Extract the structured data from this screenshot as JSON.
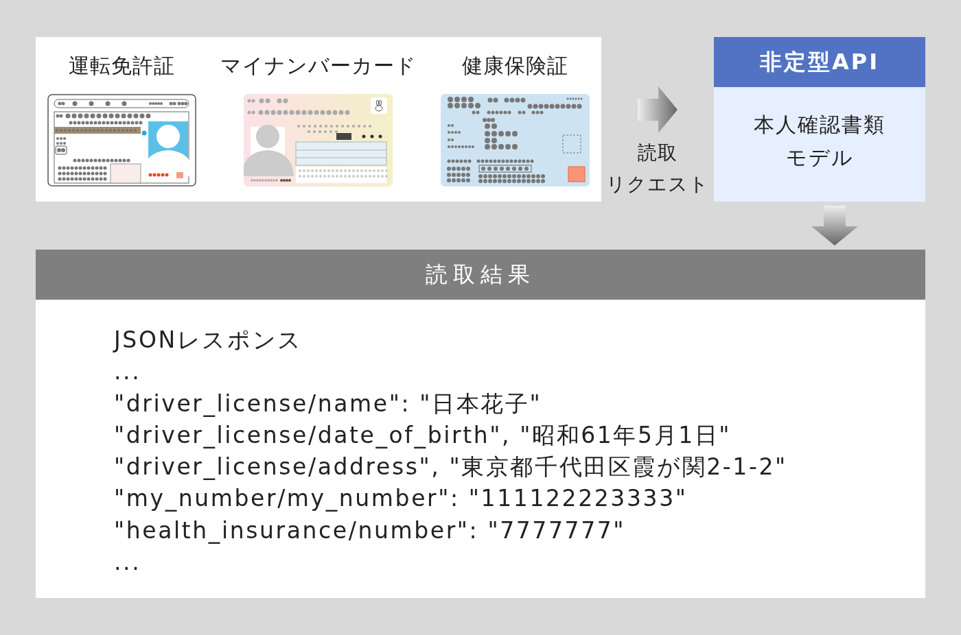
{
  "documents": [
    {
      "label": "運転免許証",
      "kind": "license"
    },
    {
      "label": "マイナンバーカード",
      "kind": "mynumber"
    },
    {
      "label": "健康保険証",
      "kind": "insurance"
    }
  ],
  "request": {
    "lines": [
      "読取",
      "リクエスト"
    ]
  },
  "api": {
    "title": "非定型API",
    "model_lines": [
      "本人確認書類",
      "モデル"
    ]
  },
  "result": {
    "title": "読取結果",
    "lines": [
      "JSONレスポンス",
      "...",
      "\"driver_license/name\": \"日本花子\"",
      "\"driver_license/date_of_birth\", \"昭和61年5月1日\"",
      "\"driver_license/address\", \"東京都千代田区霞が関2-1-2\"",
      "\"my_number/my_number\": \"111122223333\"",
      "\"health_insurance/number\": \"7777777\"",
      "..."
    ]
  }
}
